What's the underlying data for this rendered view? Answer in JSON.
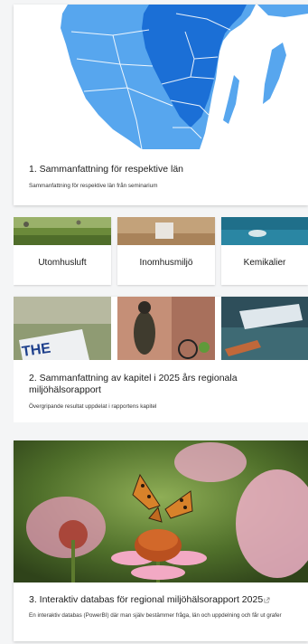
{
  "cards": [
    {
      "title": "1. Sammanfattning för respektive län",
      "description": "Sammanfattning för respektive län från seminarium",
      "image": "map-of-southern-sweden"
    },
    {
      "categories": [
        {
          "label": "Utomhusluft",
          "image": "grass-field"
        },
        {
          "label": "Inomhusmiljö",
          "image": "indoor-room"
        },
        {
          "label": "Kemikalier",
          "image": "water-surface"
        }
      ],
      "photos": [
        {
          "image": "protest-sign",
          "text": "THE"
        },
        {
          "image": "cyclist"
        },
        {
          "image": "bottle-in-water"
        }
      ],
      "title": "2. Sammanfattning av kapitel i 2025 års regionala miljöhälsorapport",
      "description": "Övergripande resultat uppdelat i rapportens kapitel"
    },
    {
      "image": "butterfly-on-coneflower",
      "title": "3. Interaktiv databas för regional miljöhälsorapport 2025",
      "external_icon": "external-link-icon",
      "description": "En interaktiv databas (PowerBI) där man själv bestämmer fråga, län och uppdelning och får ut grafer"
    }
  ],
  "colors": {
    "map_land": "#57a6ee",
    "map_highlight": "#1b6fd6",
    "map_lines": "#ffffff"
  }
}
